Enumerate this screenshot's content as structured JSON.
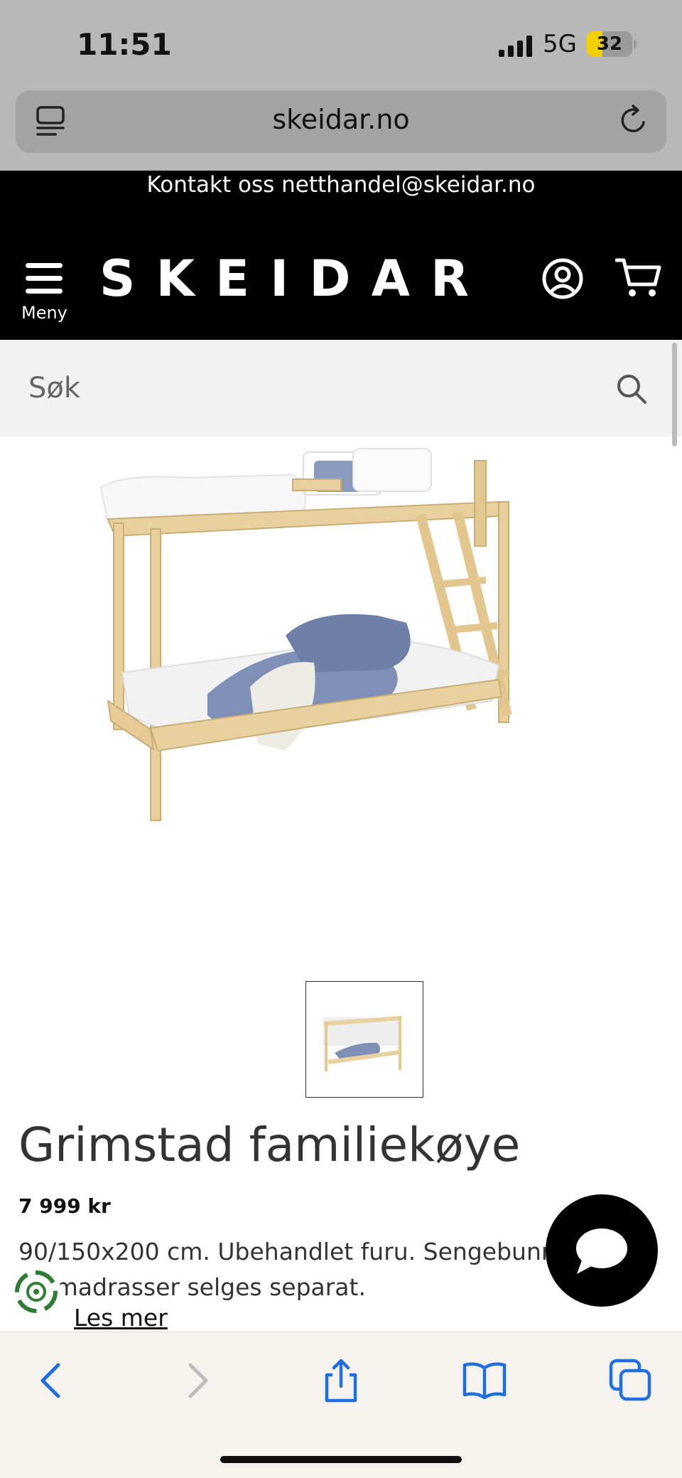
{
  "status": {
    "time": "11:51",
    "network": "5G",
    "battery": "32"
  },
  "browser": {
    "url": "skeidar.no"
  },
  "header": {
    "contact_text": "Kontakt oss netthandel@skeidar.no",
    "menu_label": "Meny",
    "brand": "SKEIDAR"
  },
  "search": {
    "placeholder": "Søk"
  },
  "product": {
    "title": "Grimstad familiekøye",
    "price": "7 999 kr",
    "description": "90/150x200 cm. Ubehandlet furu. Sengebunn og madrasser selges separat.",
    "read_more": "Les mer"
  },
  "icons": {
    "tabs": "tabs-icon",
    "reload": "reload-icon",
    "menu": "hamburger-icon",
    "account": "account-icon",
    "cart": "cart-icon",
    "search": "search-icon",
    "chat": "chat-icon",
    "eco": "eco-badge-icon",
    "back": "back-icon",
    "forward": "forward-icon",
    "share": "share-icon",
    "bookmarks": "bookmarks-icon",
    "tab_overview": "tab-overview-icon"
  },
  "colors": {
    "header_bg": "#000000",
    "toolbar_blue": "#1f6fe0",
    "eco_green": "#2e7d32"
  }
}
